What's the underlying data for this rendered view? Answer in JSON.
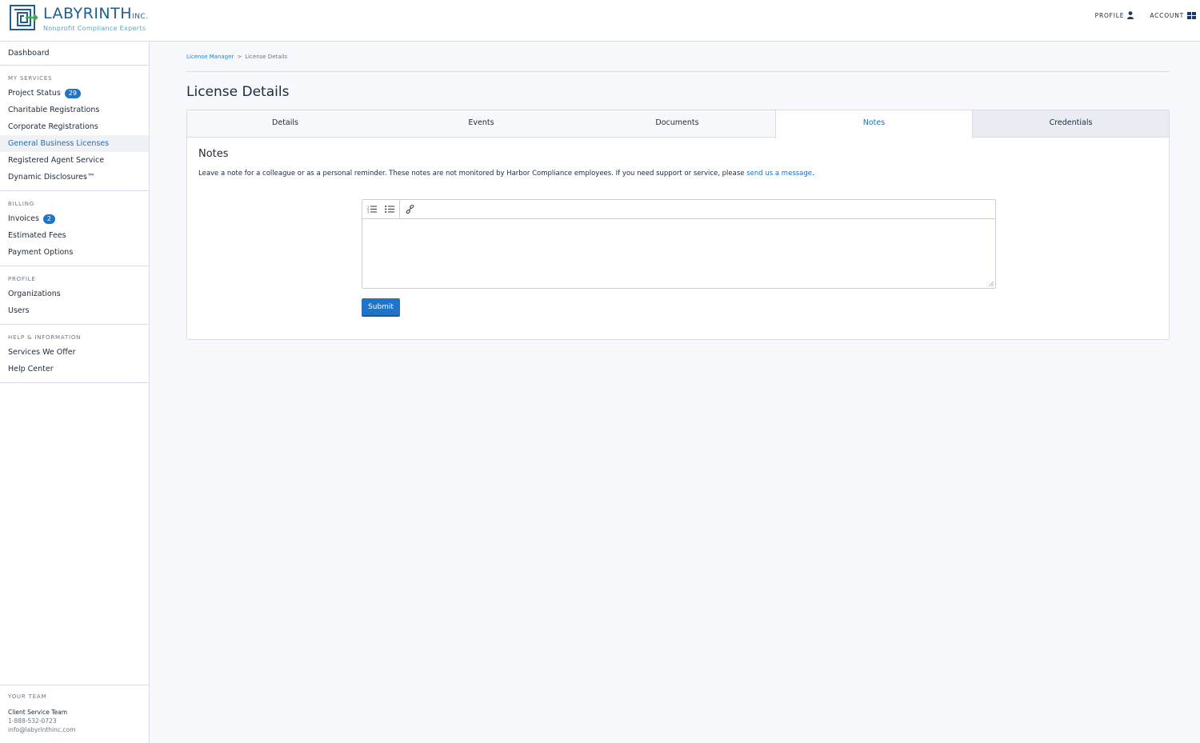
{
  "header": {
    "logo": {
      "name": "LABYRINTH",
      "inc": "INC.",
      "tagline": "Nonprofit Compliance Experts"
    },
    "nav": [
      {
        "label": "PROFILE",
        "icon": "user-icon"
      },
      {
        "label": "ACCOUNT",
        "icon": "grid-icon"
      }
    ]
  },
  "sidebar": {
    "top": [
      {
        "label": "Dashboard"
      }
    ],
    "sections": [
      {
        "heading": "MY SERVICES",
        "items": [
          {
            "label": "Project Status",
            "badge": "29"
          },
          {
            "label": "Charitable Registrations"
          },
          {
            "label": "Corporate Registrations"
          },
          {
            "label": "General Business Licenses",
            "active": true
          },
          {
            "label": "Registered Agent Service"
          },
          {
            "label": "Dynamic Disclosures™"
          }
        ]
      },
      {
        "heading": "BILLING",
        "items": [
          {
            "label": "Invoices",
            "badge": "2"
          },
          {
            "label": "Estimated Fees"
          },
          {
            "label": "Payment Options"
          }
        ]
      },
      {
        "heading": "PROFILE",
        "items": [
          {
            "label": "Organizations"
          },
          {
            "label": "Users"
          }
        ]
      },
      {
        "heading": "HELP & INFORMATION",
        "items": [
          {
            "label": "Services We Offer"
          },
          {
            "label": "Help Center"
          }
        ]
      }
    ],
    "team": {
      "heading": "YOUR TEAM",
      "name": "Client Service Team",
      "phone": "1-888-532-0723",
      "email": "info@labyrinthinc.com"
    }
  },
  "breadcrumb": {
    "parent": "License Manager",
    "separator": ">",
    "current": "License Details"
  },
  "page_title": "License Details",
  "tabs": [
    {
      "label": "Details"
    },
    {
      "label": "Events"
    },
    {
      "label": "Documents"
    },
    {
      "label": "Notes",
      "active": true
    },
    {
      "label": "Credentials"
    }
  ],
  "notes": {
    "title": "Notes",
    "description": "Leave a note for a colleague or as a personal reminder. These notes are not monitored by Harbor Compliance employees. If you need support or service, please ",
    "link": "send us a message",
    "after_link": ".",
    "editor_value": "",
    "submit_label": "Submit"
  },
  "colors": {
    "accent": "#1f74c8",
    "link": "#1f6fb8",
    "background": "#f6f8fb"
  }
}
